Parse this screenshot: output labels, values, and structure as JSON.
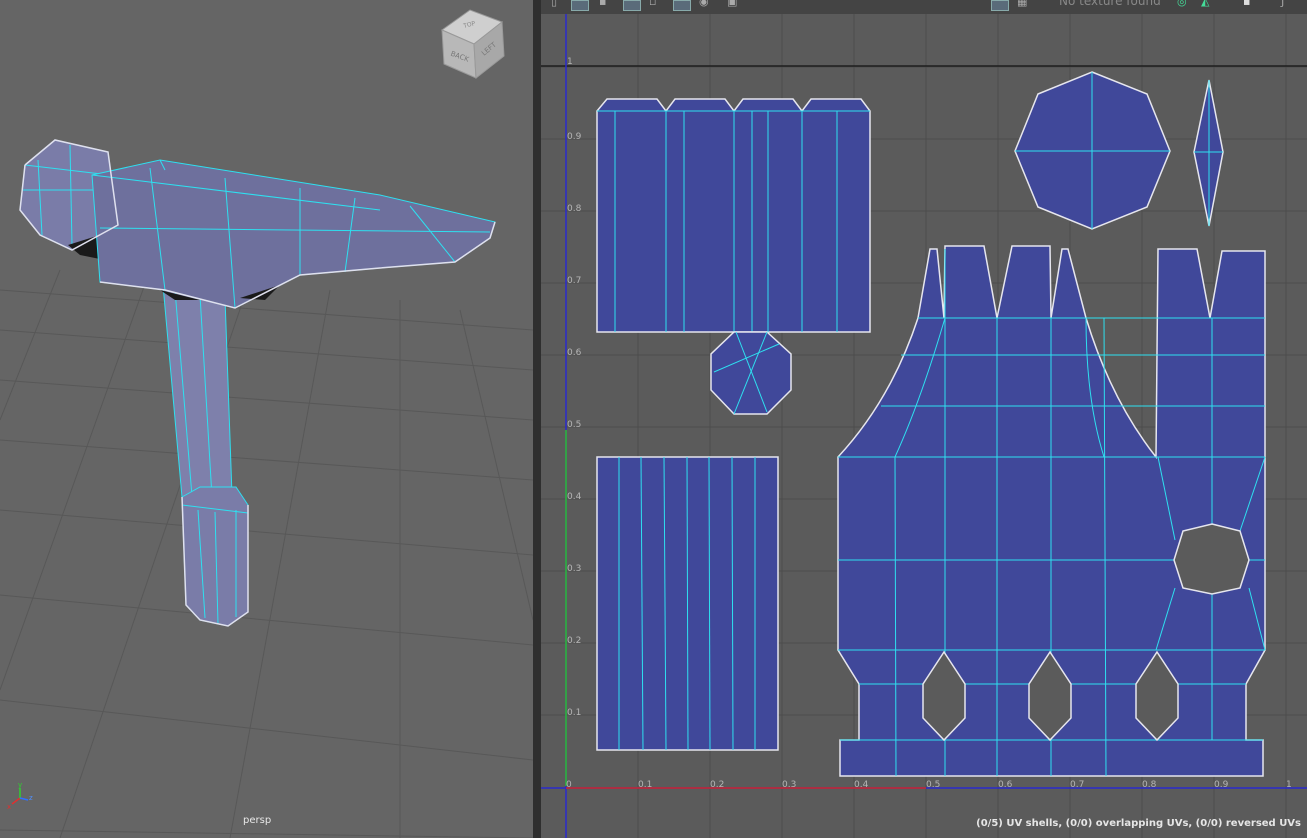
{
  "viewport": {
    "camera_label": "persp",
    "viewcube": {
      "face_back": "BACK",
      "face_left": "LEFT",
      "face_top": "TOP"
    },
    "axis": {
      "x": "x",
      "y": "y",
      "z": "z"
    }
  },
  "uv_editor": {
    "toolbar": {
      "texture_status": "No texture found"
    },
    "axis_ticks_x": [
      "0",
      "0.1",
      "0.2",
      "0.3",
      "0.4",
      "0.5",
      "0.6",
      "0.7",
      "0.8",
      "0.9",
      "1"
    ],
    "axis_ticks_y": [
      "0.1",
      "0.2",
      "0.3",
      "0.4",
      "0.5",
      "0.6",
      "0.7",
      "0.8",
      "0.9",
      "1"
    ],
    "status_bar": "(0/5) UV shells, (0/0) overlapping UVs, (0/0) reversed UVs"
  },
  "colors": {
    "shell_fill": "#40489a",
    "edge": "#2ee0f0",
    "border": "#e6e6ee"
  }
}
